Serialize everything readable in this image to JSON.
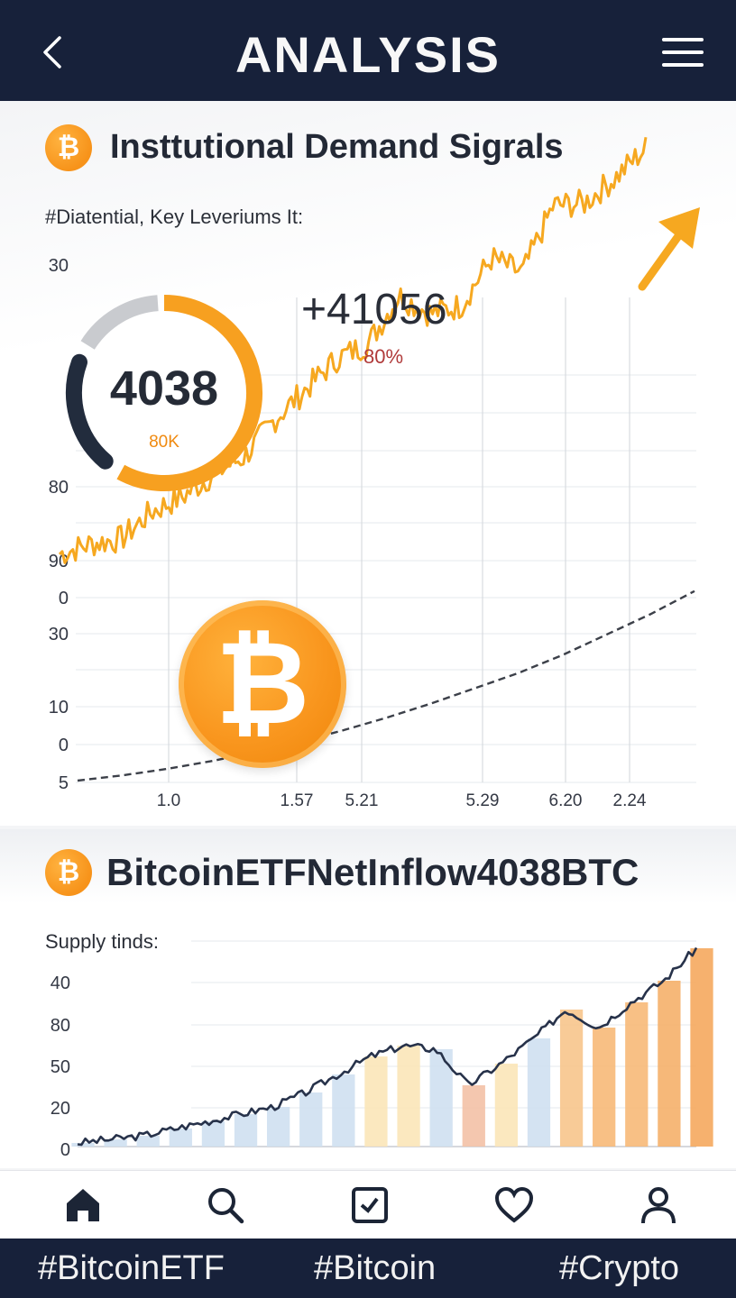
{
  "header": {
    "title": "ANALYSIS",
    "back_icon": "chevron-left-icon",
    "menu_icon": "hamburger-menu-icon"
  },
  "section1": {
    "badge_symbol": "₿",
    "title": "Insttutional Demand Sigrals",
    "subtitle": "#Diatential, Key Leveriums It:",
    "gauge": {
      "value": "4038",
      "sub": "80K",
      "fill_fraction": 0.58
    },
    "delta": "+41056",
    "delta_pct": "80%",
    "coin_symbol": "₿"
  },
  "chart_data": [
    {
      "type": "line",
      "y_tick_labels": [
        "30",
        "80",
        "90",
        "0",
        "30",
        "10",
        "0",
        "5"
      ],
      "x_tick_labels": [
        "1.0",
        "1.57",
        "5.21",
        "5.29",
        "6.20",
        "2.24"
      ],
      "series": [
        {
          "values": [
            3.0,
            3.4,
            3.6,
            4.7,
            5.3,
            6.2,
            6.9,
            8.4,
            9.6,
            10.8,
            11.4,
            13.3,
            12.6,
            12.9,
            14.8,
            14.2,
            16.9,
            17.0,
            18.0,
            19.2
          ]
        },
        {
          "values": [
            0.0,
            0.2,
            0.45,
            0.75,
            1.1,
            1.5,
            1.95,
            2.45,
            3.0,
            3.6,
            4.2,
            4.9,
            5.7,
            6.5,
            7.4
          ]
        }
      ],
      "grid": true,
      "trend_arrow": true
    },
    {
      "type": "area",
      "subtitle": "Supply tinds:",
      "y_tick_labels": [
        "40",
        "80",
        "50",
        "20",
        "0"
      ],
      "series": [
        {
          "values": [
            1,
            2,
            3,
            5,
            7,
            9,
            11,
            15,
            20,
            25,
            28,
            27,
            17,
            23,
            30,
            38,
            33,
            40,
            46,
            55
          ]
        }
      ],
      "bar_colors": [
        "#cfe0f1",
        "#cfe0f1",
        "#cfe0f1",
        "#cfe0f1",
        "#cfe0f1",
        "#cfe0f1",
        "#cfe0f1",
        "#cfe0f1",
        "#cfe0f1",
        "#fbe6b8",
        "#fbe6b8",
        "#cfe0f1",
        "#f3c1a6",
        "#fbe6b8",
        "#cfe0f1",
        "#f7c58c",
        "#f7b978",
        "#f7b978",
        "#f5b06a",
        "#f5a95e"
      ],
      "grid": true
    }
  ],
  "section2": {
    "badge_symbol": "₿",
    "title": "BitcoinETFNetInflow4038BTC",
    "subtitle": "Supply tinds:"
  },
  "nav": {
    "items": [
      {
        "icon": "home-icon",
        "active": true
      },
      {
        "icon": "search-icon",
        "active": false
      },
      {
        "icon": "checkbox-icon",
        "active": false
      },
      {
        "icon": "heart-icon",
        "active": false
      },
      {
        "icon": "user-icon",
        "active": false
      }
    ]
  },
  "tags": [
    "#BitcoinETF",
    "#Bitcoin",
    "#Crypto"
  ],
  "colors": {
    "navy": "#17213a",
    "orange": "#f7a51e",
    "bitcoin": "#f7931a",
    "grid": "#e6e8ec"
  }
}
